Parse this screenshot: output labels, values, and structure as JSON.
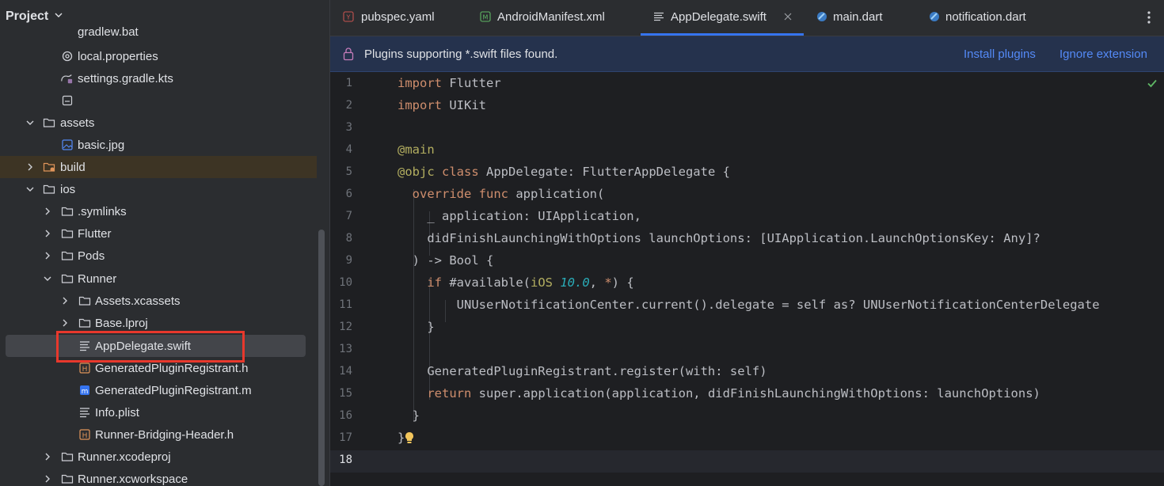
{
  "sidebar": {
    "title": "Project",
    "items": [
      {
        "label": "gradlew.bat",
        "icon": "file-icon",
        "kind": "file"
      },
      {
        "label": "local.properties",
        "icon": "gear-icon",
        "kind": "file"
      },
      {
        "label": "settings.gradle.kts",
        "icon": "gradle-icon",
        "kind": "file"
      },
      {
        "label": "",
        "icon": "text-file-icon",
        "kind": "file"
      },
      {
        "label": "assets",
        "icon": "folder-icon",
        "kind": "folder",
        "expanded": true
      },
      {
        "label": "basic.jpg",
        "icon": "image-icon",
        "kind": "file"
      },
      {
        "label": "build",
        "icon": "folder-excluded-icon",
        "kind": "folder",
        "expanded": false
      },
      {
        "label": "ios",
        "icon": "folder-icon",
        "kind": "folder",
        "expanded": true
      },
      {
        "label": ".symlinks",
        "icon": "folder-icon",
        "kind": "folder",
        "expanded": false
      },
      {
        "label": "Flutter",
        "icon": "folder-icon",
        "kind": "folder",
        "expanded": false
      },
      {
        "label": "Pods",
        "icon": "folder-icon",
        "kind": "folder",
        "expanded": false
      },
      {
        "label": "Runner",
        "icon": "folder-icon",
        "kind": "folder",
        "expanded": true
      },
      {
        "label": "Assets.xcassets",
        "icon": "folder-icon",
        "kind": "folder",
        "expanded": false
      },
      {
        "label": "Base.lproj",
        "icon": "folder-icon",
        "kind": "folder",
        "expanded": false
      },
      {
        "label": "AppDelegate.swift",
        "icon": "text-file-icon",
        "kind": "file",
        "selected": true
      },
      {
        "label": "GeneratedPluginRegistrant.h",
        "icon": "header-file-icon",
        "kind": "file"
      },
      {
        "label": "GeneratedPluginRegistrant.m",
        "icon": "objc-file-icon",
        "kind": "file"
      },
      {
        "label": "Info.plist",
        "icon": "text-file-icon",
        "kind": "file"
      },
      {
        "label": "Runner-Bridging-Header.h",
        "icon": "header-file-icon",
        "kind": "file"
      },
      {
        "label": "Runner.xcodeproj",
        "icon": "folder-icon",
        "kind": "folder",
        "expanded": false
      },
      {
        "label": "Runner.xcworkspace",
        "icon": "folder-icon",
        "kind": "folder",
        "expanded": false
      }
    ]
  },
  "tabs": [
    {
      "label": "pubspec.yaml",
      "icon": "yaml-icon",
      "active": false
    },
    {
      "label": "AndroidManifest.xml",
      "icon": "manifest-icon",
      "active": false
    },
    {
      "label": "AppDelegate.swift",
      "icon": "text-file-icon",
      "active": true,
      "closable": true
    },
    {
      "label": "main.dart",
      "icon": "dart-icon",
      "active": false
    },
    {
      "label": "notification.dart",
      "icon": "dart-icon",
      "active": false
    }
  ],
  "banner": {
    "message": "Plugins supporting *.swift files found.",
    "install_label": "Install plugins",
    "ignore_label": "Ignore extension"
  },
  "editor": {
    "line_numbers": [
      "1",
      "2",
      "3",
      "4",
      "5",
      "6",
      "7",
      "8",
      "9",
      "10",
      "11",
      "12",
      "13",
      "14",
      "15",
      "16",
      "17",
      "18"
    ],
    "current_line": "18"
  },
  "colors": {
    "keyword": "#cf8e6d",
    "annotation": "#b3ae60",
    "number": "#2aacb8",
    "link": "#548af7",
    "accent": "#3574f0",
    "highlight_box": "#e8382c"
  }
}
